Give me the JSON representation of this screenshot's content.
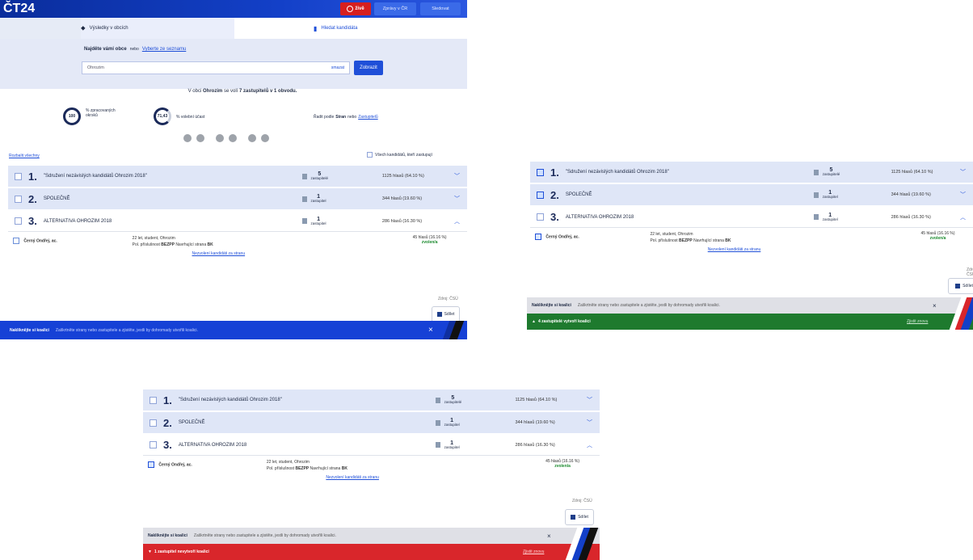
{
  "header": {
    "logo": "ČT24",
    "live_label": "živě",
    "news_label": "Zprávy v ČR",
    "select_label": "Sledovat"
  },
  "tabs": [
    {
      "label": "Výsledky v obcích",
      "icon": "map-pin-icon"
    },
    {
      "label": "Hledat kandidáta",
      "icon": "person-search-icon"
    }
  ],
  "search": {
    "heading": "Najděte vámi obce",
    "heading_sub": "nebo",
    "list_link": "Vyberte ze seznamu",
    "input_value": "Ohrozim",
    "input_action": "smazat",
    "button": "Zobrazit"
  },
  "summary": {
    "text_prefix": "V obci",
    "municipality": "Ohrozim",
    "text_mid": "se volí",
    "seats_count": "7 zastupitelů",
    "text_end": "v 1 obvodu.",
    "circle1_value": "100",
    "circle1_label": "% zpracovaných okrsků",
    "circle2_value": "71,43",
    "circle2_label": "% volební účast",
    "sort_label": "Řadit podle",
    "sort_active": "Stran",
    "sort_or": "nebo",
    "sort_link": "Zastupitelů"
  },
  "controls": {
    "expand_all": "Rozbalit všechny",
    "show_candidates": "Všech kandidátů, kteří zastupují"
  },
  "parties": [
    {
      "num": "1.",
      "name": "\"Sdružení nezávislých kandidátů Ohrozim 2018\"",
      "seats": "5",
      "seats_label": "zastupitelé",
      "votes": "1125 hlasů (64.10 %)"
    },
    {
      "num": "2.",
      "name": "SPOLEČNĚ",
      "seats": "1",
      "seats_label": "zastupitel",
      "votes": "344 hlasů (19.60 %)"
    },
    {
      "num": "3.",
      "name": "ALTERNATIVA OHROZIM 2018",
      "seats": "1",
      "seats_label": "zastupitel",
      "votes": "286 hlasů (16.30 %)"
    }
  ],
  "candidate": {
    "name": "Černý Ondřej, ac.",
    "details1": "22 let, student, Ohrozim",
    "details2_prefix": "Pol. příslušnost",
    "party": "BEZPP",
    "details2_mid": "Navrhující strana",
    "nominating": "BK",
    "votes": "45 hlasů (16.16 %)",
    "status": "zvolen/a",
    "more_link": "Nezvolení kandidáti za stranu"
  },
  "share": {
    "label": "Sdílet",
    "small_label": "Zdroj: ČSÚ"
  },
  "coalition": {
    "title": "Nakliknějte si koalici",
    "desc": "Zaškrtněte strany nebo zastupitele a zjistěte, jestli by dohromady utvořili koalici.",
    "close": "×",
    "success": "4 zastupitelé vytvoří koalici",
    "fail": "1 zastupitel nevytvoří koalici",
    "action": "Zjistit znovu"
  },
  "colors": {
    "brand_blue": "#1340c8",
    "success_green": "#1e7a2e",
    "fail_red": "#d9262b",
    "row_shade": "#dfe6f7"
  }
}
